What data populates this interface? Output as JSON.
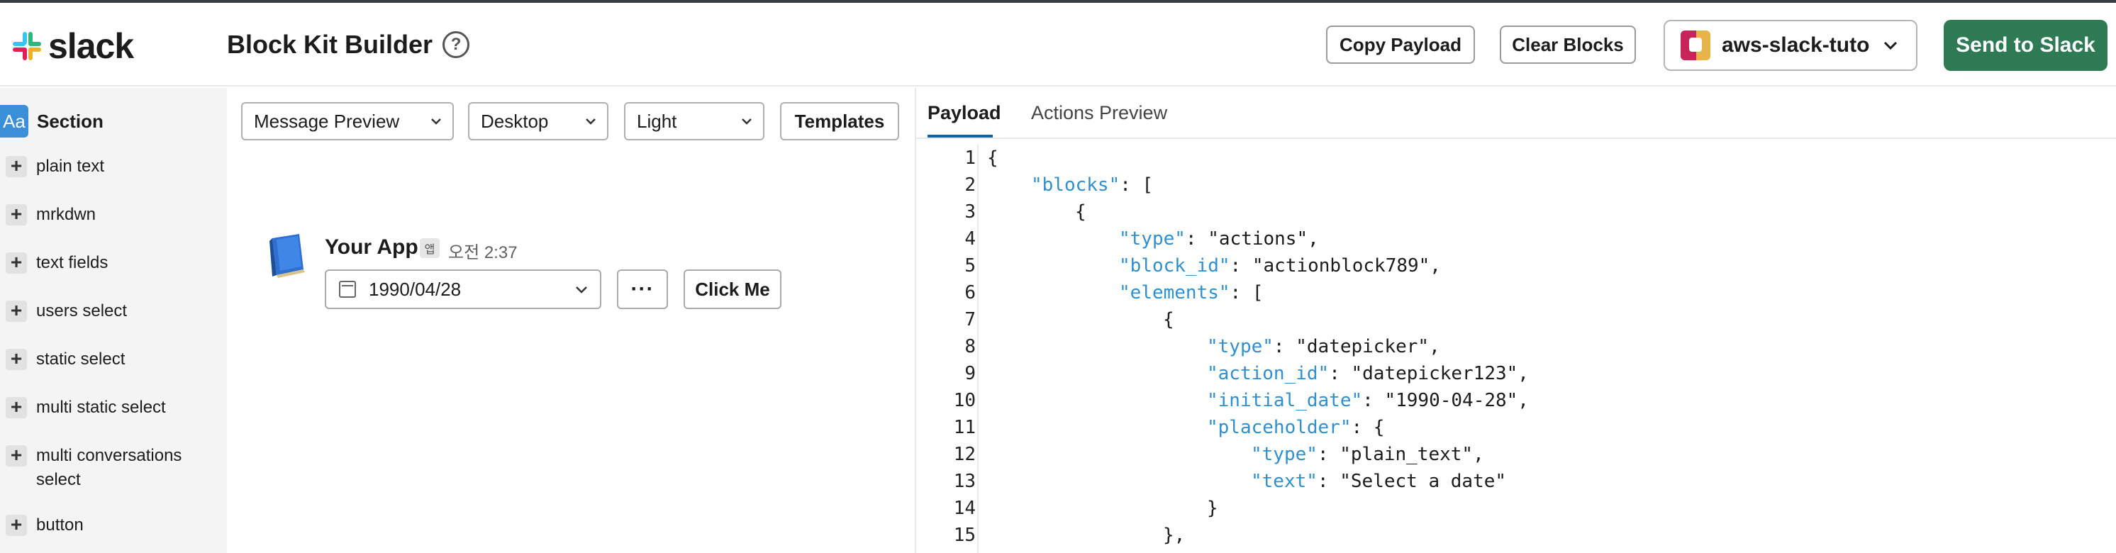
{
  "header": {
    "logo_text": "slack",
    "title": "Block Kit Builder",
    "help_glyph": "?",
    "copy_payload": "Copy Payload",
    "clear_blocks": "Clear Blocks",
    "workspace_name": "aws-slack-tutorial",
    "send_to_slack": "Send to Slack",
    "colors": {
      "send_button": "#2d7a55",
      "workspace_icon_left": "#c7245a",
      "workspace_icon_right": "#e8b44a"
    }
  },
  "sidebar": {
    "section_icon": "Aa",
    "section_label": "Section",
    "items": [
      {
        "icon": "plus-icon",
        "label": "plain text"
      },
      {
        "icon": "plus-icon",
        "label": "mrkdwn"
      },
      {
        "icon": "plus-icon",
        "label": "text fields"
      },
      {
        "icon": "plus-icon",
        "label": "users select"
      },
      {
        "icon": "plus-icon",
        "label": "static select"
      },
      {
        "icon": "plus-icon",
        "label": "multi static select"
      },
      {
        "icon": "plus-icon",
        "label": "multi conversations select"
      },
      {
        "icon": "plus-icon",
        "label": "button"
      }
    ]
  },
  "preview": {
    "mode": "Message Preview",
    "device": "Desktop",
    "theme": "Light",
    "templates": "Templates",
    "message": {
      "app_name": "Your App",
      "app_badge": "앱",
      "time": "오전 2:37",
      "date_value": "1990/04/28",
      "overflow": "···",
      "button_label": "Click Me"
    }
  },
  "payload_panel": {
    "tabs": [
      "Payload",
      "Actions Preview"
    ],
    "active_tab": "Payload",
    "code_lines": [
      {
        "n": "1",
        "indent": 0,
        "key": "",
        "rest": "{"
      },
      {
        "n": "2",
        "indent": 1,
        "key": "\"blocks\"",
        "rest": ": ["
      },
      {
        "n": "3",
        "indent": 2,
        "key": "",
        "rest": "{"
      },
      {
        "n": "4",
        "indent": 3,
        "key": "\"type\"",
        "rest": ": \"actions\","
      },
      {
        "n": "5",
        "indent": 3,
        "key": "\"block_id\"",
        "rest": ": \"actionblock789\","
      },
      {
        "n": "6",
        "indent": 3,
        "key": "\"elements\"",
        "rest": ": ["
      },
      {
        "n": "7",
        "indent": 4,
        "key": "",
        "rest": "{"
      },
      {
        "n": "8",
        "indent": 5,
        "key": "\"type\"",
        "rest": ": \"datepicker\","
      },
      {
        "n": "9",
        "indent": 5,
        "key": "\"action_id\"",
        "rest": ": \"datepicker123\","
      },
      {
        "n": "10",
        "indent": 5,
        "key": "\"initial_date\"",
        "rest": ": \"1990-04-28\","
      },
      {
        "n": "11",
        "indent": 5,
        "key": "\"placeholder\"",
        "rest": ": {"
      },
      {
        "n": "12",
        "indent": 6,
        "key": "\"type\"",
        "rest": ": \"plain_text\","
      },
      {
        "n": "13",
        "indent": 6,
        "key": "\"text\"",
        "rest": ": \"Select a date\""
      },
      {
        "n": "14",
        "indent": 5,
        "key": "",
        "rest": "}"
      },
      {
        "n": "15",
        "indent": 4,
        "key": "",
        "rest": "},"
      }
    ]
  }
}
